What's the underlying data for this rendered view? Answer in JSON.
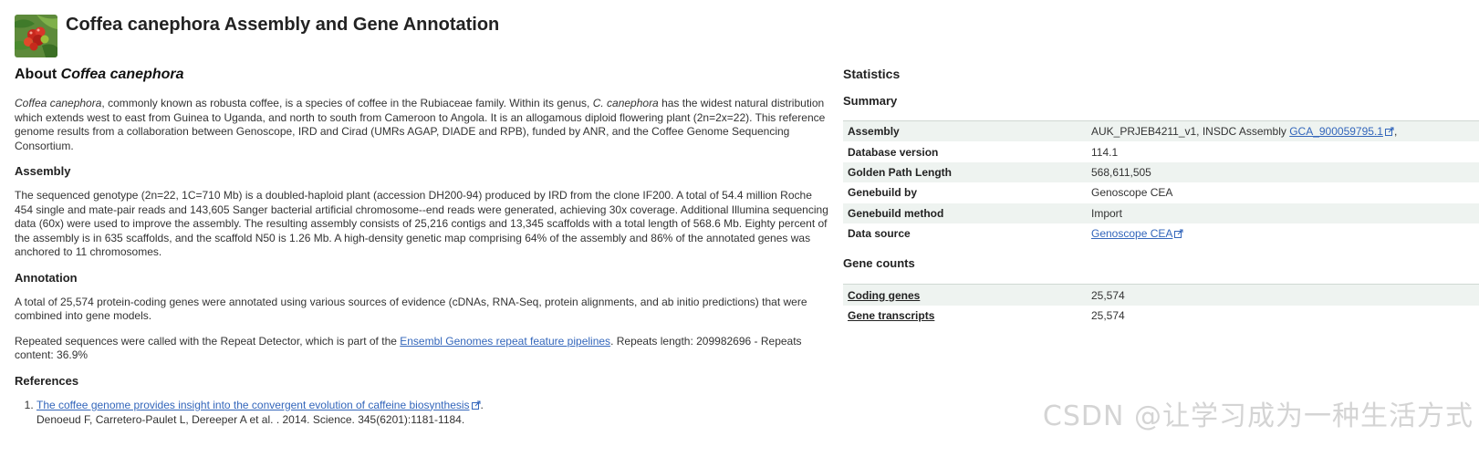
{
  "header": {
    "title": "Coffea canephora Assembly and Gene Annotation",
    "logo_icon": "coffee-cherries-icon"
  },
  "about": {
    "title_prefix": "About",
    "title_species": "Coffea canephora",
    "p1_species": "Coffea canephora",
    "p1_a": ", commonly known as robusta coffee, is a species of coffee in the Rubiaceae family. Within its genus, ",
    "p1_species_short": "C. canephora",
    "p1_b": " has the widest natural distribution which extends west to east from Guinea to Uganda, and north to south from Cameroon to Angola. It is an allogamous diploid flowering plant (2n=2x=22). This reference genome results from a collaboration between Genoscope, IRD and Cirad (UMRs AGAP, DIADE and RPB), funded by ANR, and the Coffee Genome Sequencing Consortium."
  },
  "assembly": {
    "heading": "Assembly",
    "text": "The sequenced genotype (2n=22, 1C=710 Mb) is a doubled-haploid plant (accession DH200-94) produced by IRD from the clone IF200. A total of 54.4 million Roche 454 single and mate-pair reads and 143,605 Sanger bacterial artificial chromosome--end reads were generated, achieving 30x coverage. Additional Illumina sequencing data (60x) were used to improve the assembly. The resulting assembly consists of 25,216 contigs and 13,345 scaffolds with a total length of 568.6 Mb. Eighty percent of the assembly is in 635 scaffolds, and the scaffold N50 is 1.26 Mb. A high-density genetic map comprising 64% of the assembly and 86% of the annotated genes was anchored to 11 chromosomes."
  },
  "annotation": {
    "heading": "Annotation",
    "text1": "A total of 25,574 protein-coding genes were annotated using various sources of evidence (cDNAs, RNA-Seq, protein alignments, and ab initio predictions) that were combined into gene models.",
    "text2_a": "Repeated sequences were called with the Repeat Detector, which is part of the ",
    "text2_link": "Ensembl Genomes repeat feature pipelines",
    "text2_b": ". Repeats length: 209982696 - Repeats content: 36.9%"
  },
  "references": {
    "heading": "References",
    "items": [
      {
        "title": "The coffee genome provides insight into the convergent evolution of caffeine biosynthesis",
        "after_link": ".",
        "citation": "Denoeud F, Carretero-Paulet L, Dereeper A et al. . 2014. Science. 345(6201):1181-1184."
      }
    ]
  },
  "statistics": {
    "title": "Statistics",
    "summary_title": "Summary",
    "summary": {
      "assembly_key": "Assembly",
      "assembly_val": "AUK_PRJEB4211_v1, INSDC Assembly ",
      "assembly_link": "GCA_900059795.1",
      "assembly_after": ",",
      "dbver_key": "Database version",
      "dbver_val": "114.1",
      "gpl_key": "Golden Path Length",
      "gpl_val": "568,611,505",
      "gb_by_key": "Genebuild by",
      "gb_by_val": "Genoscope CEA",
      "gb_method_key": "Genebuild method",
      "gb_method_val": "Import",
      "source_key": "Data source",
      "source_link": "Genoscope CEA"
    },
    "gene_counts_title": "Gene counts",
    "gene_counts": {
      "coding_key": "Coding genes",
      "coding_val": "25,574",
      "transcripts_key": "Gene transcripts",
      "transcripts_val": "25,574"
    }
  },
  "watermark": "CSDN @让学习成为一种生活方式",
  "colors": {
    "link": "#3366bb",
    "row_shade": "#eef3f0",
    "watermark": "#d4d4d4"
  }
}
